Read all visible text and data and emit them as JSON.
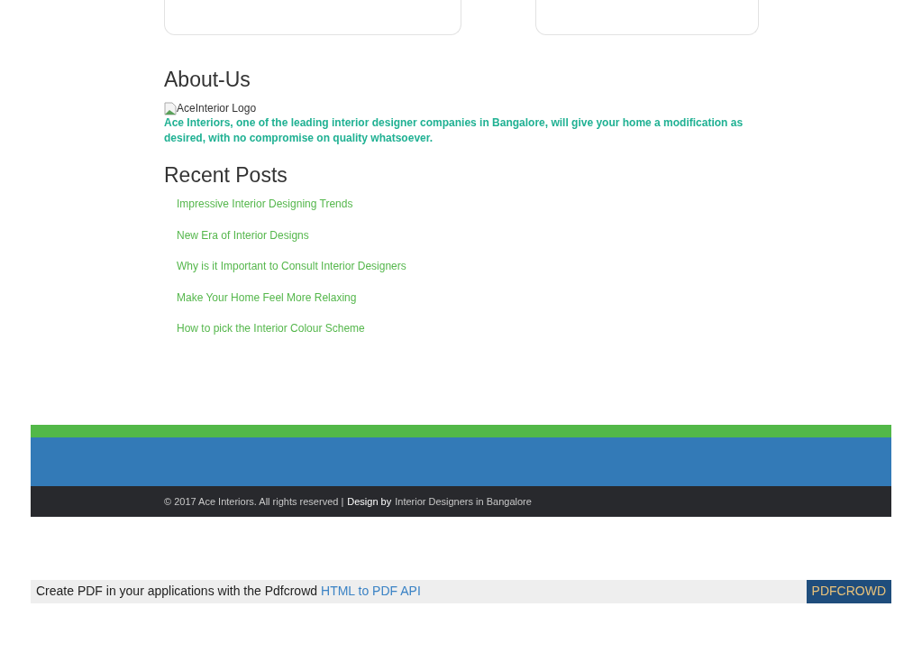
{
  "about": {
    "heading": "About-Us",
    "logo_alt": "AceInterior Logo",
    "description": "Ace Interiors, one of the leading interior designer companies in Bangalore, will give your home a modification as desired, with no compromise on quality whatsoever."
  },
  "recent_posts": {
    "heading": "Recent Posts",
    "items": [
      "Impressive Interior Designing Trends",
      "New Era of Interior Designs",
      "Why is it Important to Consult Interior Designers",
      "Make Your Home Feel More Relaxing",
      "How to pick the Interior Colour Scheme"
    ]
  },
  "footer": {
    "copyright": "© 2017 Ace Interiors. All rights reserved |",
    "design_by": "Design by",
    "designer_link": "Interior Designers in Bangalore"
  },
  "pdf_banner": {
    "text": "Create PDF in your applications with the Pdfcrowd",
    "link": "HTML to PDF API",
    "badge": "PDFCROWD"
  }
}
